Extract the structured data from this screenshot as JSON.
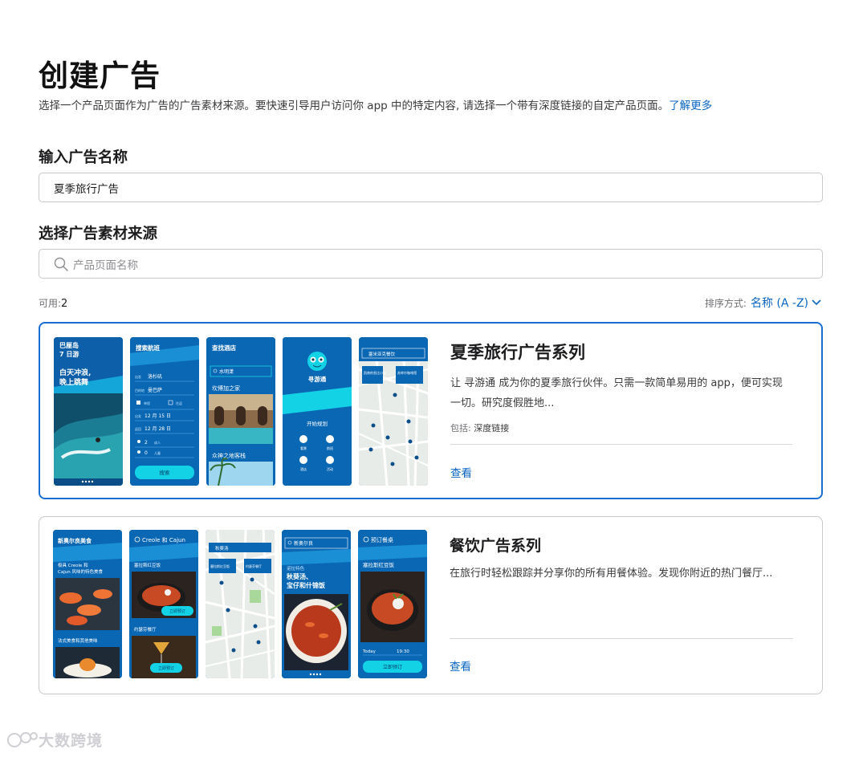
{
  "page": {
    "title": "创建广告",
    "intro_text": "选择一个产品页面作为广告的广告素材来源。要快速引导用户访问你 app 中的特定内容, 请选择一个带有深度链接的自定产品页面。",
    "intro_link": "了解更多"
  },
  "ad_name": {
    "label": "输入广告名称",
    "value": "夏季旅行广告"
  },
  "source": {
    "label": "选择广告素材来源",
    "search_placeholder": "产品页面名称",
    "available_label": "可用:",
    "available_count": "2",
    "sort_label": "排序方式:",
    "sort_value": "名称 (A -Z)"
  },
  "cards": [
    {
      "title": "夏季旅行广告系列",
      "description": "让 寻游通 成为你的夏季旅行伙伴。只需一款简单易用的 app，便可实现一切。研究度假胜地...",
      "tags_label": "包括:",
      "tags_value": "深度链接",
      "link": "查看",
      "thumbs": {
        "t1_title": "巴厘岛",
        "t1_sub": "7 日游",
        "t1_headline_a": "白天冲浪,",
        "t1_headline_b": "晚上跳舞",
        "t2_title": "搜索航班",
        "t2_from_label": "出发",
        "t2_from": "洛杉矶",
        "t2_to_label": "目的地",
        "t2_to": "曼巴萨",
        "t2_oneway": "单程",
        "t2_round": "往返",
        "t2_date1_label": "出发",
        "t2_date1": "12 月 15 日",
        "t2_date2_label": "返回",
        "t2_date2": "12 月 28 日",
        "t2_adults_n": "2",
        "t2_adults": "成人",
        "t2_kids_n": "0",
        "t2_kids": "儿童",
        "t2_button": "搜索",
        "t3_title": "查找酒店",
        "t3_search": "水明漾",
        "t3_hotel1": "坎博加之家",
        "t3_hotel2": "众神之地客栈",
        "t4_brand": "寻游通",
        "t4_cta": "开始规划",
        "t4_i1": "看景",
        "t4_i2": "航班",
        "t4_i3": "酒店",
        "t4_i4": "活动",
        "t5_search": "塞米亚克餐饮",
        "t5_pin1": "凯南的息比小屋",
        "t5_pin2": "苏库尔咖啡馆"
      }
    },
    {
      "title": "餐饮广告系列",
      "description": "在旅行时轻松跟踪并分享你的所有用餐体验。发现你附近的热门餐厅...",
      "link": "查看",
      "thumbs": {
        "t1_title": "新奥尔良美食",
        "t1_dish1_a": "极具 Creole 和",
        "t1_dish1_b": "Cajun 风味的特色美食",
        "t1_dish2": "法式美食和其他美味",
        "t2_title": "Creole 和 Cajun",
        "t2_item1": "塞拉斯红豆饭",
        "t2_btn1": "立即预订",
        "t2_item2": "约瑟芬餐厅",
        "t2_btn2": "立即预订",
        "t3_search": "秋葵汤",
        "t3_pin1": "塞拉斯红豆饭",
        "t3_pin2": "约瑟芬餐厅",
        "t4_search": "新奥尔良",
        "t4_tag": "诺拉特色",
        "t4_head_a": "秋葵汤、",
        "t4_head_b": "宝仔和什锦饭",
        "t5_title": "预订餐桌",
        "t5_dish": "塞拉斯红豆饭",
        "t5_day": "Today",
        "t5_time": "19:30",
        "t5_button": "立即预订"
      }
    }
  ],
  "watermark": "大数跨境",
  "colors": {
    "accent": "#0a66c2",
    "app_blue": "#0a67b3",
    "app_cyan": "#14d2e6"
  }
}
